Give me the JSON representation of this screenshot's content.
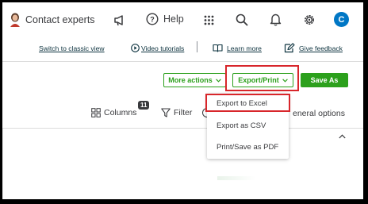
{
  "header": {
    "contact_experts": "Contact experts",
    "help": "Help",
    "avatar_initial": "C",
    "icons": [
      "megaphone-icon",
      "help-icon",
      "apps-grid-icon",
      "search-icon",
      "bell-icon",
      "gear-icon"
    ]
  },
  "links": {
    "classic_view": "Switch to classic view",
    "video_tutorials": "Video tutorials",
    "learn_more": "Learn more",
    "give_feedback": "Give feedback"
  },
  "actions": {
    "more_actions": "More actions",
    "export_print": "Export/Print",
    "save_as": "Save As"
  },
  "dropdown": {
    "items": [
      "Export to Excel",
      "Export as CSV",
      "Print/Save as PDF"
    ]
  },
  "toolbar": {
    "columns_label": "Columns",
    "columns_count": "11",
    "filter_label": "Filter",
    "general_options_partial": "eneral options"
  },
  "colors": {
    "accent_green": "#2ca01c",
    "avatar_blue": "#0077c5",
    "highlight_red": "#d8262b"
  }
}
